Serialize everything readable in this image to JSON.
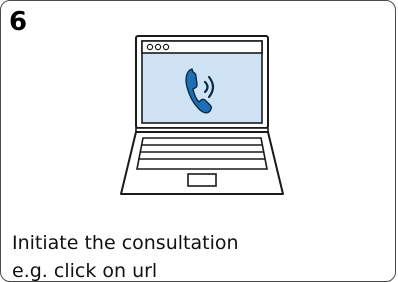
{
  "step": {
    "number": "6",
    "title": "Initiate the consultation",
    "subtitle": "e.g. click on url"
  },
  "illustration": {
    "icon": "laptop-video-call-icon",
    "screen_color": "#cfe3f5",
    "phone_color": "#1d6fb5"
  }
}
